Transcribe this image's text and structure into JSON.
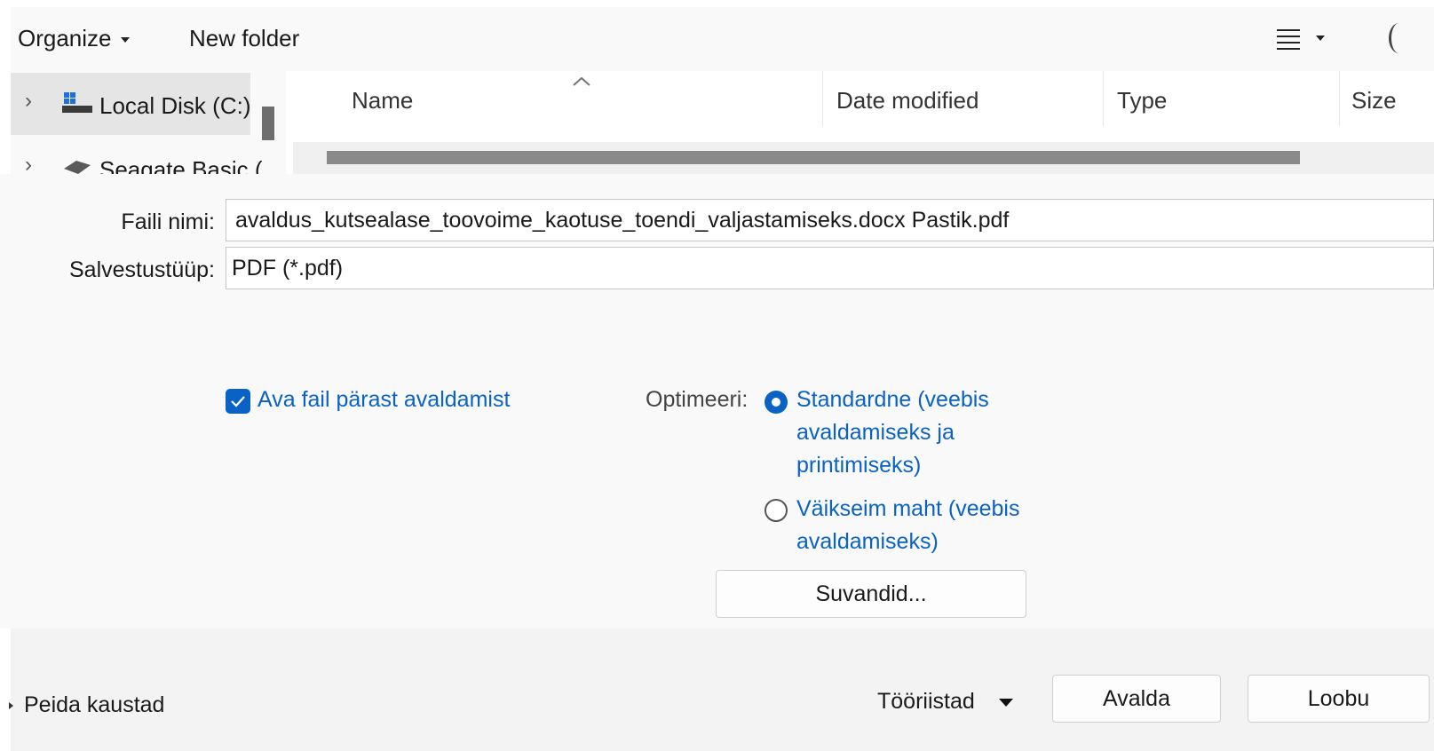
{
  "toolbar": {
    "organize_label": "Organize",
    "new_folder_label": "New folder"
  },
  "nav": {
    "items": [
      {
        "label": "Local Disk (C:)",
        "icon": "drive-icon"
      },
      {
        "label": "Seagate Basic (",
        "icon": "external-drive-icon"
      }
    ]
  },
  "list": {
    "columns": [
      "Name",
      "Date modified",
      "Type",
      "Size"
    ]
  },
  "form": {
    "filename_label": "Faili nimi:",
    "filename_value": "avaldus_kutsealase_toovoime_kaotuse_toendi_valjastamiseks.docx Pastik.pdf",
    "savetype_label": "Salvestustüüp:",
    "savetype_value": "PDF (*.pdf)",
    "open_after_label": "Ava fail pärast avaldamist",
    "optimize_label": "Optimeeri:",
    "opt_standard_lines": [
      "Standardne (veebis",
      "avaldamiseks ja",
      "printimiseks)"
    ],
    "opt_min_lines": [
      "Väikseim maht (veebis",
      "avaldamiseks)"
    ],
    "options_button": "Suvandid..."
  },
  "footer": {
    "hide_folders_label": "Peida kaustad",
    "tools_label": "Tööriistad",
    "publish_button": "Avalda",
    "cancel_button": "Loobu"
  },
  "colors": {
    "accent": "#0a62c4"
  }
}
